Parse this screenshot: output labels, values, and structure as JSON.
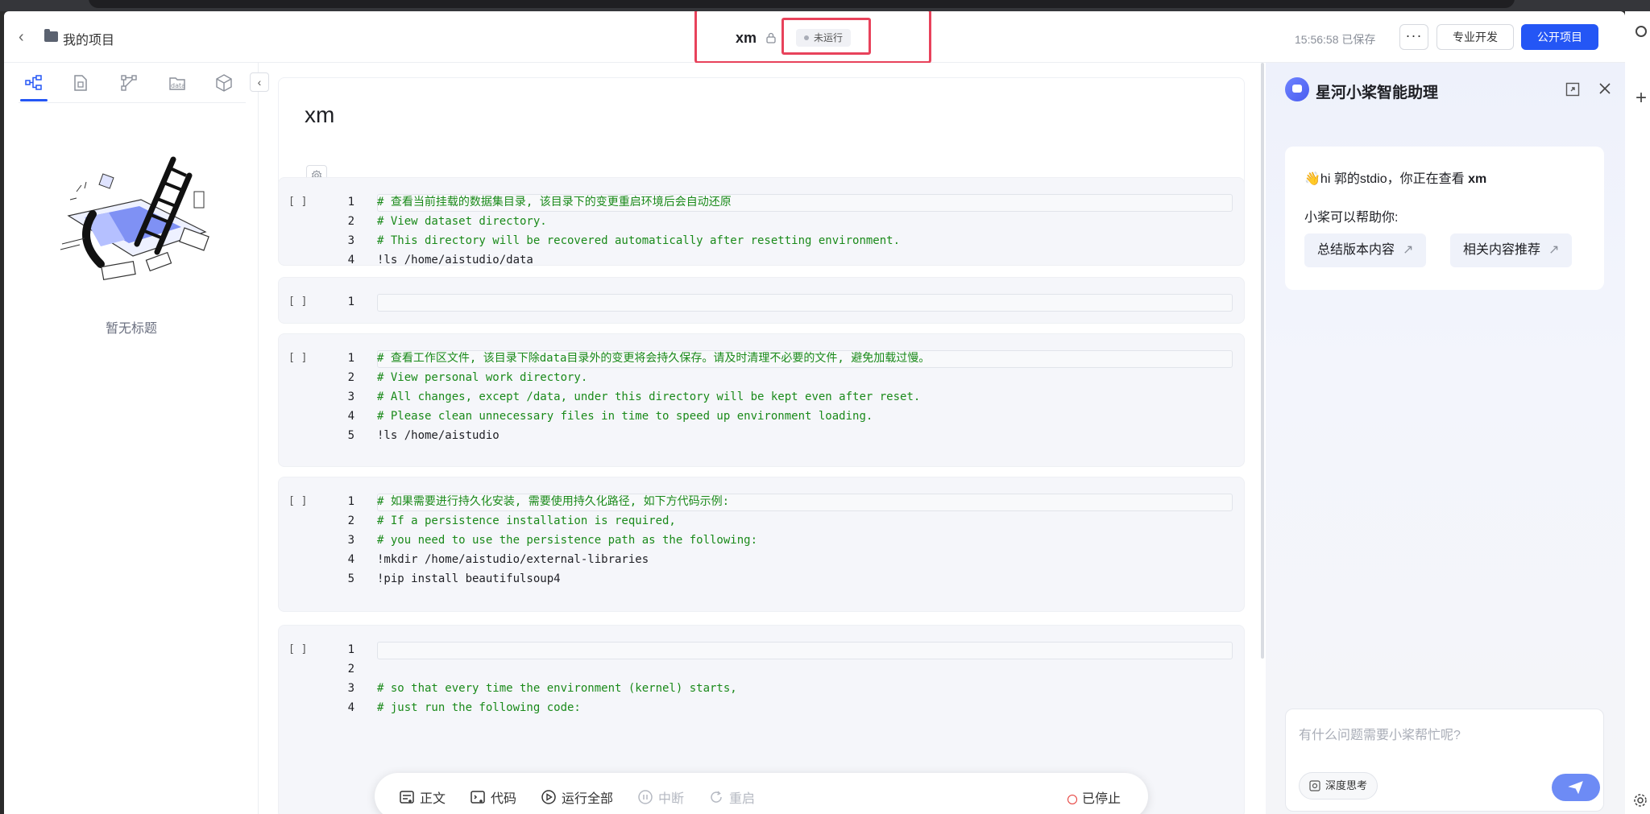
{
  "header": {
    "back_label": "我的项目",
    "project_title": "xm",
    "status": "未运行",
    "save_status": "15:56:58 已保存",
    "more_label": "···",
    "pro_dev_label": "专业开发",
    "public_label": "公开项目"
  },
  "sidebar": {
    "tabs": [
      "outline-icon",
      "file-icon",
      "model-icon",
      "data-icon",
      "package-icon"
    ],
    "tab_data_label": "data",
    "collapse_label": "‹",
    "empty_title": "暂无标题"
  },
  "notebook": {
    "title": "xm",
    "cells": [
      {
        "run": "[ ]",
        "lines": [
          {
            "n": "1",
            "text": "# 查看当前挂载的数据集目录, 该目录下的变更重启环境后会自动还原",
            "type": "cm"
          },
          {
            "n": "2",
            "text": "# View dataset directory.",
            "type": "cm"
          },
          {
            "n": "3",
            "text": "# This directory will be recovered automatically after resetting environment.",
            "type": "cm"
          },
          {
            "n": "4",
            "text": "!ls /home/aistudio/data",
            "type": "cmd"
          }
        ]
      },
      {
        "run": "[ ]",
        "lines": [
          {
            "n": "1",
            "text": "",
            "type": "cmd"
          }
        ]
      },
      {
        "run": "[ ]",
        "lines": [
          {
            "n": "1",
            "text": "# 查看工作区文件, 该目录下除data目录外的变更将会持久保存。请及时清理不必要的文件, 避免加载过慢。",
            "type": "cm"
          },
          {
            "n": "2",
            "text": "# View personal work directory.",
            "type": "cm"
          },
          {
            "n": "3",
            "text": "# All changes, except /data, under this directory will be kept even after reset.",
            "type": "cm"
          },
          {
            "n": "4",
            "text": "# Please clean unnecessary files in time to speed up environment loading.",
            "type": "cm"
          },
          {
            "n": "5",
            "text": "!ls /home/aistudio",
            "type": "cmd"
          }
        ]
      },
      {
        "run": "[ ]",
        "lines": [
          {
            "n": "1",
            "text": "# 如果需要进行持久化安装, 需要使用持久化路径, 如下方代码示例:",
            "type": "cm"
          },
          {
            "n": "2",
            "text": "# If a persistence installation is required,",
            "type": "cm"
          },
          {
            "n": "3",
            "text": "# you need to use the persistence path as the following:",
            "type": "cm"
          },
          {
            "n": "4",
            "text": "!mkdir /home/aistudio/external-libraries",
            "type": "cmd"
          },
          {
            "n": "5",
            "text": "!pip install beautifulsoup4",
            "type": "cmd"
          }
        ]
      },
      {
        "run": "[ ]",
        "lines": [
          {
            "n": "1",
            "text": "",
            "type": "cm"
          },
          {
            "n": "2",
            "text": "",
            "type": "cm"
          },
          {
            "n": "3",
            "text": "# so that every time the environment (kernel) starts,",
            "type": "cm"
          },
          {
            "n": "4",
            "text": "# just run the following code:",
            "type": "cm"
          }
        ]
      }
    ]
  },
  "toolbar": {
    "text_label": "正文",
    "code_label": "代码",
    "run_all_label": "运行全部",
    "interrupt_label": "中断",
    "restart_label": "重启",
    "stopped_label": "已停止"
  },
  "assistant": {
    "title": "星河小桨智能助理",
    "greeting_prefix": "👋hi 郭的stdio，你正在查看 ",
    "greeting_project": "xm",
    "help_label": "小桨可以帮助你:",
    "suggestions": [
      "总结版本内容",
      "相关内容推荐"
    ],
    "input_placeholder": "有什么问题需要小桨帮忙呢?",
    "deep_think_label": "深度思考"
  },
  "colors": {
    "primary": "#2456f5",
    "comment_green": "#1a8a1a",
    "highlight_red": "#e8425b",
    "stop_red": "#e53935"
  }
}
